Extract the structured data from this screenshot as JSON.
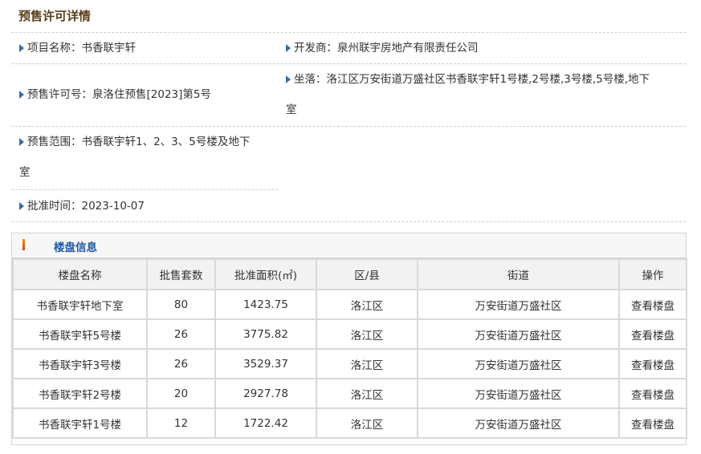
{
  "page": {
    "title": "预售许可详情"
  },
  "info": {
    "project_name": "项目名称：书香联宇轩",
    "developer": "开发商：泉州联宇房地产有限责任公司",
    "permit_no": "预售许可号：泉洛住预售[2023]第5号",
    "location_line1": "坐落：洛江区万安街道万盛社区书香联宇轩1号楼,2号楼,3号楼,5号楼,地下",
    "location_line2": "室",
    "scope_line1": "预售范围：书香联宇轩1、2、3、5号楼及地下",
    "scope_line2": "室",
    "approval_date": "批准时间：2023-10-07"
  },
  "panel": {
    "title": "楼盘信息"
  },
  "table": {
    "headers": [
      "楼盘名称",
      "批售套数",
      "批准面积(㎡)",
      "区/县",
      "街道",
      "操作"
    ],
    "rows": [
      [
        "书香联宇轩地下室",
        "80",
        "1423.75",
        "洛江区",
        "万安街道万盛社区",
        "查看楼盘"
      ],
      [
        "书香联宇轩5号楼",
        "26",
        "3775.82",
        "洛江区",
        "万安街道万盛社区",
        "查看楼盘"
      ],
      [
        "书香联宇轩3号楼",
        "26",
        "3529.37",
        "洛江区",
        "万安街道万盛社区",
        "查看楼盘"
      ],
      [
        "书香联宇轩2号楼",
        "20",
        "2927.78",
        "洛江区",
        "万安街道万盛社区",
        "查看楼盘"
      ],
      [
        "书香联宇轩1号楼",
        "12",
        "1722.42",
        "洛江区",
        "万安街道万盛社区",
        "查看楼盘"
      ]
    ]
  },
  "colors": {
    "accent": "#1f5aa8",
    "title": "#5a3e1b",
    "bullet": "#3a6ea5"
  },
  "icons": {
    "bullet": "triangle-right-icon",
    "panel_mark": "bar-icon"
  }
}
